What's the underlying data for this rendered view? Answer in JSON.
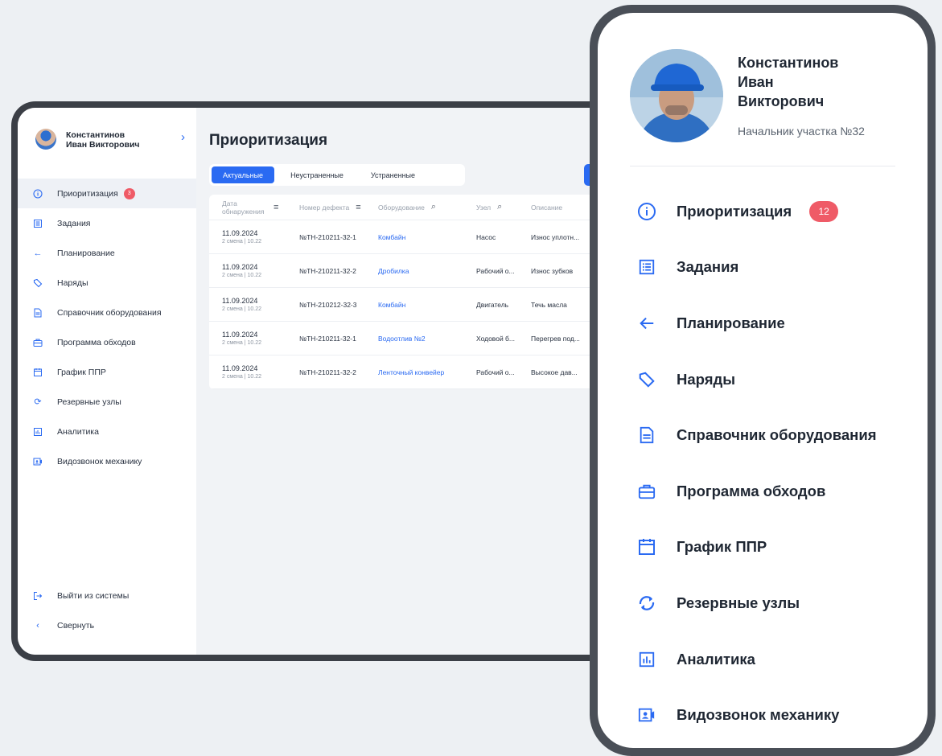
{
  "user": {
    "name_tablet_line1": "Константинов",
    "name_tablet_line2": "Иван Викторович",
    "name_phone_line1": "Константинов",
    "name_phone_line2": "Иван",
    "name_phone_line3": "Викторович",
    "role": "Начальник участка №32"
  },
  "nav": [
    {
      "label": "Приоритизация",
      "icon": "info-icon",
      "badge": "12"
    },
    {
      "label": "Задания",
      "icon": "task-list-icon"
    },
    {
      "label": "Планирование",
      "icon": "arrow-left-icon"
    },
    {
      "label": "Наряды",
      "icon": "tag-icon"
    },
    {
      "label": "Справочник оборудования",
      "icon": "document-icon"
    },
    {
      "label": "Программа обходов",
      "icon": "briefcase-icon"
    },
    {
      "label": "График ППР",
      "icon": "calendar-icon"
    },
    {
      "label": "Резервные узлы",
      "icon": "sync-icon"
    },
    {
      "label": "Аналитика",
      "icon": "analytics-icon"
    },
    {
      "label": "Видозвонок механику",
      "icon": "video-call-icon"
    }
  ],
  "nav_bottom": {
    "logout": "Выйти из системы",
    "collapse": "Свернуть"
  },
  "tablet_badge": "3",
  "page": {
    "title": "Приоритизация",
    "tabs": [
      "Актуальные",
      "Неустраненные",
      "Устраненные"
    ],
    "action_label": "Пер"
  },
  "table": {
    "headers": [
      "Дата обнаружения",
      "Номер дефекта",
      "Оборудование",
      "Узел",
      "Описание"
    ],
    "rows": [
      {
        "date": "11.09.2024",
        "shift": "2 смена | 10.22",
        "number": "№TH-210211-32-1",
        "equipment": "Комбайн",
        "node": "Насос",
        "desc": "Износ уплотн..."
      },
      {
        "date": "11.09.2024",
        "shift": "2 смена | 10.22",
        "number": "№TH-210211-32-2",
        "equipment": "Дробилка",
        "node": "Рабочий о...",
        "desc": "Износ зубков"
      },
      {
        "date": "11.09.2024",
        "shift": "2 смена | 10.22",
        "number": "№TH-210212-32-3",
        "equipment": "Комбайн",
        "node": "Двигатель",
        "desc": "Течь масла"
      },
      {
        "date": "11.09.2024",
        "shift": "2 смена | 10.22",
        "number": "№TH-210211-32-1",
        "equipment": "Водоотлив №2",
        "node": "Ходовой б...",
        "desc": "Перегрев под..."
      },
      {
        "date": "11.09.2024",
        "shift": "2 смена | 10.22",
        "number": "№TH-210211-32-2",
        "equipment": "Ленточный конвейер",
        "node": "Рабочий о...",
        "desc": "Высокое дав..."
      }
    ]
  },
  "colors": {
    "accent": "#2a6af2",
    "badge": "#ef5b67",
    "text": "#1f2733"
  }
}
